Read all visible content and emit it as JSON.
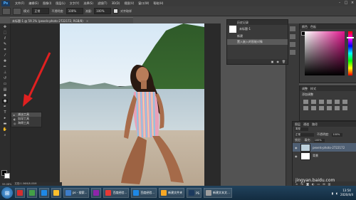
{
  "menubar": {
    "logo": "Ps",
    "items": [
      "文件(F)",
      "编辑(E)",
      "图像(I)",
      "图层(L)",
      "文字(Y)",
      "选择(S)",
      "滤镜(T)",
      "3D(D)",
      "视图(V)",
      "窗口(W)",
      "帮助(H)"
    ],
    "window_controls": [
      "-",
      "□",
      "×"
    ]
  },
  "optbar": {
    "mode_label": "模式:",
    "mode_value": "正常",
    "opacity_label": "不透明度:",
    "opacity_value": "100%",
    "flow_label": "流量:",
    "flow_value": "100%",
    "align_label": "对齐取样"
  },
  "document": {
    "tab_title": "未标题-1 @ 59.1% (pexels-photo-2722172, RGB/8)",
    "close": "×"
  },
  "flyout": {
    "items": [
      {
        "icon": "▸",
        "label": "减淡工具",
        "shortcut": "O"
      },
      {
        "icon": "◐",
        "label": "加深工具",
        "shortcut": "O"
      },
      {
        "icon": "◎",
        "label": "海绵工具",
        "shortcut": "O"
      }
    ]
  },
  "history": {
    "title": "历史记录",
    "snapshot_name": "未标题-1",
    "rows": [
      "新建",
      "置入嵌入的智能对象"
    ],
    "footer_icons": [
      "▣",
      "◉",
      "🗑"
    ]
  },
  "color_panel": {
    "tabs": [
      "颜色",
      "色板"
    ],
    "fg_color": "#000000",
    "accent": "#e0148c"
  },
  "adjust_panel": {
    "tabs": [
      "调整",
      "样式"
    ],
    "subtitle": "添加调整"
  },
  "layers_panel": {
    "tabs": [
      "图层",
      "通道",
      "路径"
    ],
    "filter_label": "类型",
    "blend_mode": "正常",
    "opacity_label": "不透明度:",
    "opacity_value": "100%",
    "fill_label": "填充:",
    "fill_value": "100%",
    "lock_label": "锁定:",
    "layers": [
      {
        "name": "pexels-photo-2722172",
        "selected": true
      },
      {
        "name": "背景",
        "selected": false
      }
    ]
  },
  "status": {
    "zoom": "59.08%",
    "doc": "文档:1.56M/8.05M"
  },
  "taskbar": {
    "items": [
      {
        "label": "",
        "color": "#d32f2f"
      },
      {
        "label": "",
        "color": "#43a047"
      },
      {
        "label": "",
        "color": "#1e88e5"
      },
      {
        "label": "",
        "color": "#fbc02d"
      },
      {
        "label": "ps - 搜索...",
        "color": "#3d7dca"
      },
      {
        "label": "",
        "color": "#8e24aa"
      },
      {
        "label": "百度经验...",
        "color": "#e53935"
      },
      {
        "label": "百度经验...",
        "color": "#1e88e5"
      },
      {
        "label": "新建文件夹",
        "color": "#f9a825"
      },
      {
        "label": "PS",
        "color": "#1c3a5e"
      },
      {
        "label": "新建文本文...",
        "color": "#9e9e9e"
      }
    ]
  },
  "tray": {
    "time": "13:54",
    "date": "2020/4/4"
  },
  "watermark": "jingyan.baidu.com"
}
